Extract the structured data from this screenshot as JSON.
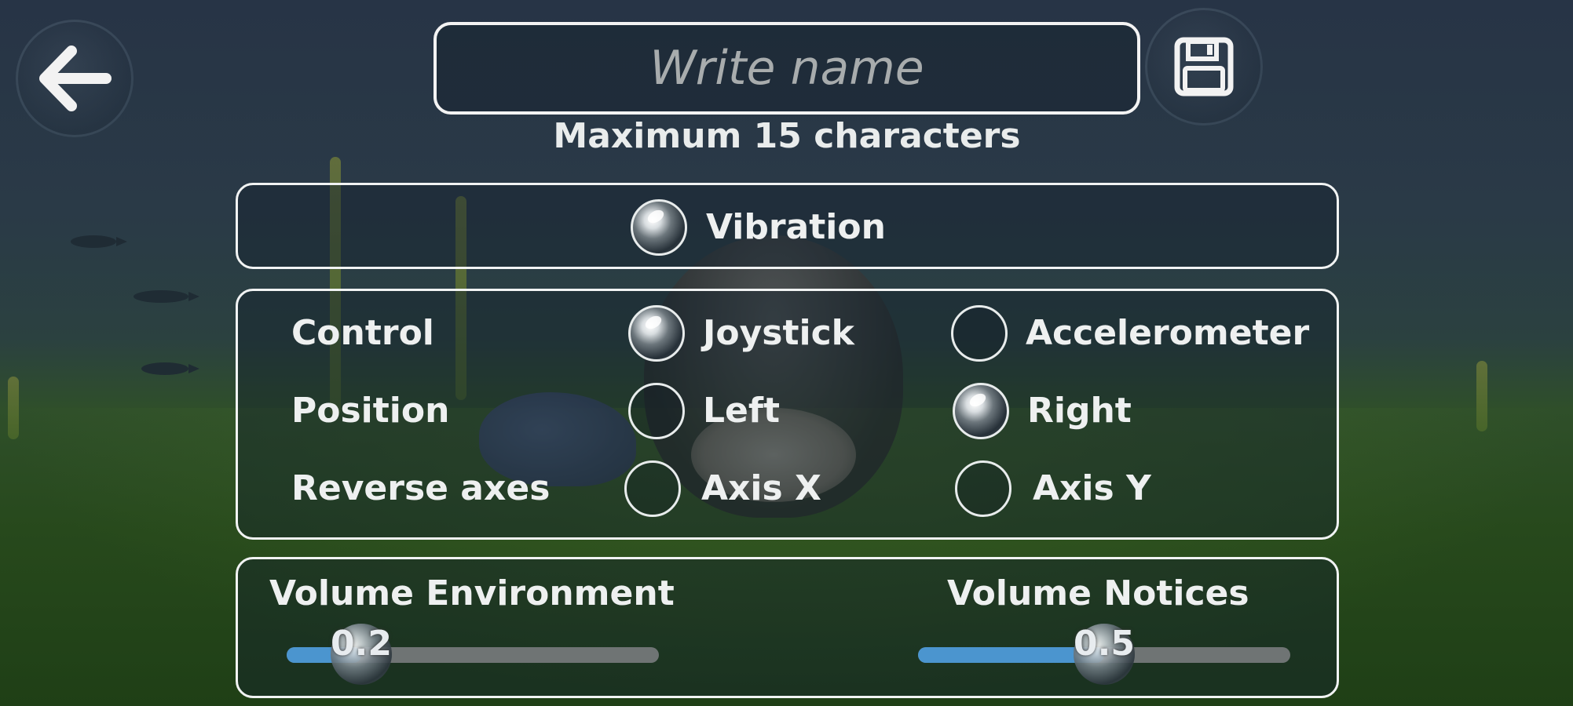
{
  "header": {
    "back_icon": "arrow-left-icon",
    "save_icon": "floppy-disk-icon",
    "name_placeholder": "Write name",
    "name_value": "",
    "hint": "Maximum 15 characters"
  },
  "vibration": {
    "label": "Vibration",
    "checked": true
  },
  "control_panel": {
    "control": {
      "label": "Control",
      "options": [
        {
          "label": "Joystick",
          "selected": true
        },
        {
          "label": "Accelerometer",
          "selected": false
        }
      ]
    },
    "position": {
      "label": "Position",
      "options": [
        {
          "label": "Left",
          "selected": false
        },
        {
          "label": "Right",
          "selected": true
        }
      ]
    },
    "reverse_axes": {
      "label": "Reverse axes",
      "options": [
        {
          "label": "Axis X",
          "selected": false
        },
        {
          "label": "Axis Y",
          "selected": false
        }
      ]
    }
  },
  "volume": {
    "environment": {
      "label": "Volume Environment",
      "value": 0.2,
      "display": "0.2"
    },
    "notices": {
      "label": "Volume Notices",
      "value": 0.5,
      "display": "0.5"
    }
  },
  "colors": {
    "accent": "#4b95cf",
    "track": "#6f7474",
    "border": "#f1f3f3"
  }
}
